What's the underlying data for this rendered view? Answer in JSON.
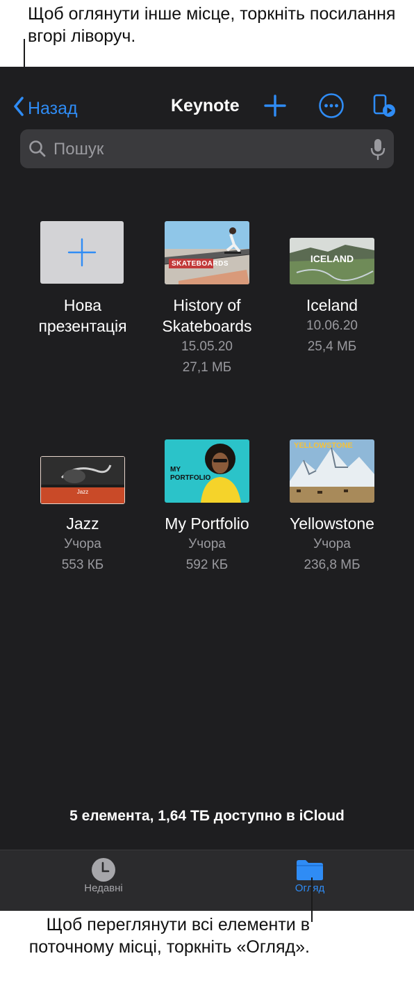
{
  "callouts": {
    "top": "Щоб оглянути інше місце, торкніть посилання вгорі ліворуч.",
    "bottom": "Щоб переглянути всі елементи в поточному місці, торкніть «Огляд»."
  },
  "nav": {
    "back_label": "Назад",
    "title": "Keynote",
    "icons": [
      "chevron-left-icon",
      "plus-icon",
      "ellipsis-circle-icon",
      "remote-play-icon"
    ]
  },
  "search": {
    "placeholder": "Пошук",
    "value": ""
  },
  "documents": [
    {
      "name_lines": [
        "Нова",
        "презентація"
      ],
      "date": "",
      "size": ""
    },
    {
      "name_lines": [
        "History of",
        "Skateboards"
      ],
      "date": "15.05.20",
      "size": "27,1 МБ",
      "thumb_text": "SKATEBOARDS"
    },
    {
      "name_lines": [
        "Iceland"
      ],
      "date": "10.06.20",
      "size": "25,4 МБ",
      "thumb_text": "ICELAND"
    },
    {
      "name_lines": [
        "Jazz"
      ],
      "date": "Учора",
      "size": "553 КБ",
      "thumb_text": "Jazz"
    },
    {
      "name_lines": [
        "My Portfolio"
      ],
      "date": "Учора",
      "size": "592 КБ",
      "thumb_text": "MY PORTFOLIO"
    },
    {
      "name_lines": [
        "Yellowstone"
      ],
      "date": "Учора",
      "size": "236,8 МБ",
      "thumb_text": "YELLOWSTONE"
    }
  ],
  "storage_text": "5 елемента, 1,64 ТБ доступно в iCloud",
  "tabs": [
    {
      "label": "Недавні",
      "icon": "clock-icon",
      "active": false
    },
    {
      "label": "Огляд",
      "icon": "folder-icon",
      "active": true
    }
  ],
  "colors": {
    "accent": "#2f8cf5",
    "background": "#1e1e20",
    "tabbar": "#2b2b2d",
    "secondary_text": "#9a9a9f"
  }
}
